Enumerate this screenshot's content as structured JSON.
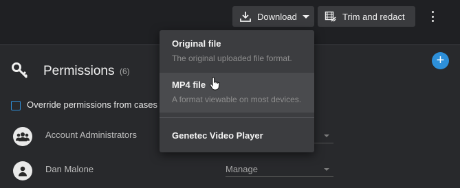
{
  "toolbar": {
    "download_label": "Download",
    "trim_label": "Trim and redact"
  },
  "permissions": {
    "title": "Permissions",
    "count": "(6)",
    "override_label": "Override permissions from cases",
    "rows": [
      {
        "name": "Account Administrators",
        "role": ""
      },
      {
        "name": "Dan Malone",
        "role": "Manage"
      }
    ]
  },
  "download_menu": {
    "items": [
      {
        "title": "Original file",
        "description": "The original uploaded file format."
      },
      {
        "title": "MP4 file",
        "description": "A format viewable on most devices."
      },
      {
        "title": "Genetec Video Player",
        "description": ""
      }
    ]
  },
  "icons": {
    "download": "download-icon",
    "trim": "film-edit-icon",
    "more": "more-vertical-icon",
    "permissions": "key-icon",
    "add": "plus-icon",
    "group": "group-icon",
    "user": "user-icon",
    "cursor": "hand-pointer-icon"
  },
  "colors": {
    "accent": "#2d8fd9",
    "background": "#1e1f22",
    "panel": "#28292c",
    "menu": "#3c3d40",
    "menu_hover": "#4a4b4e"
  }
}
